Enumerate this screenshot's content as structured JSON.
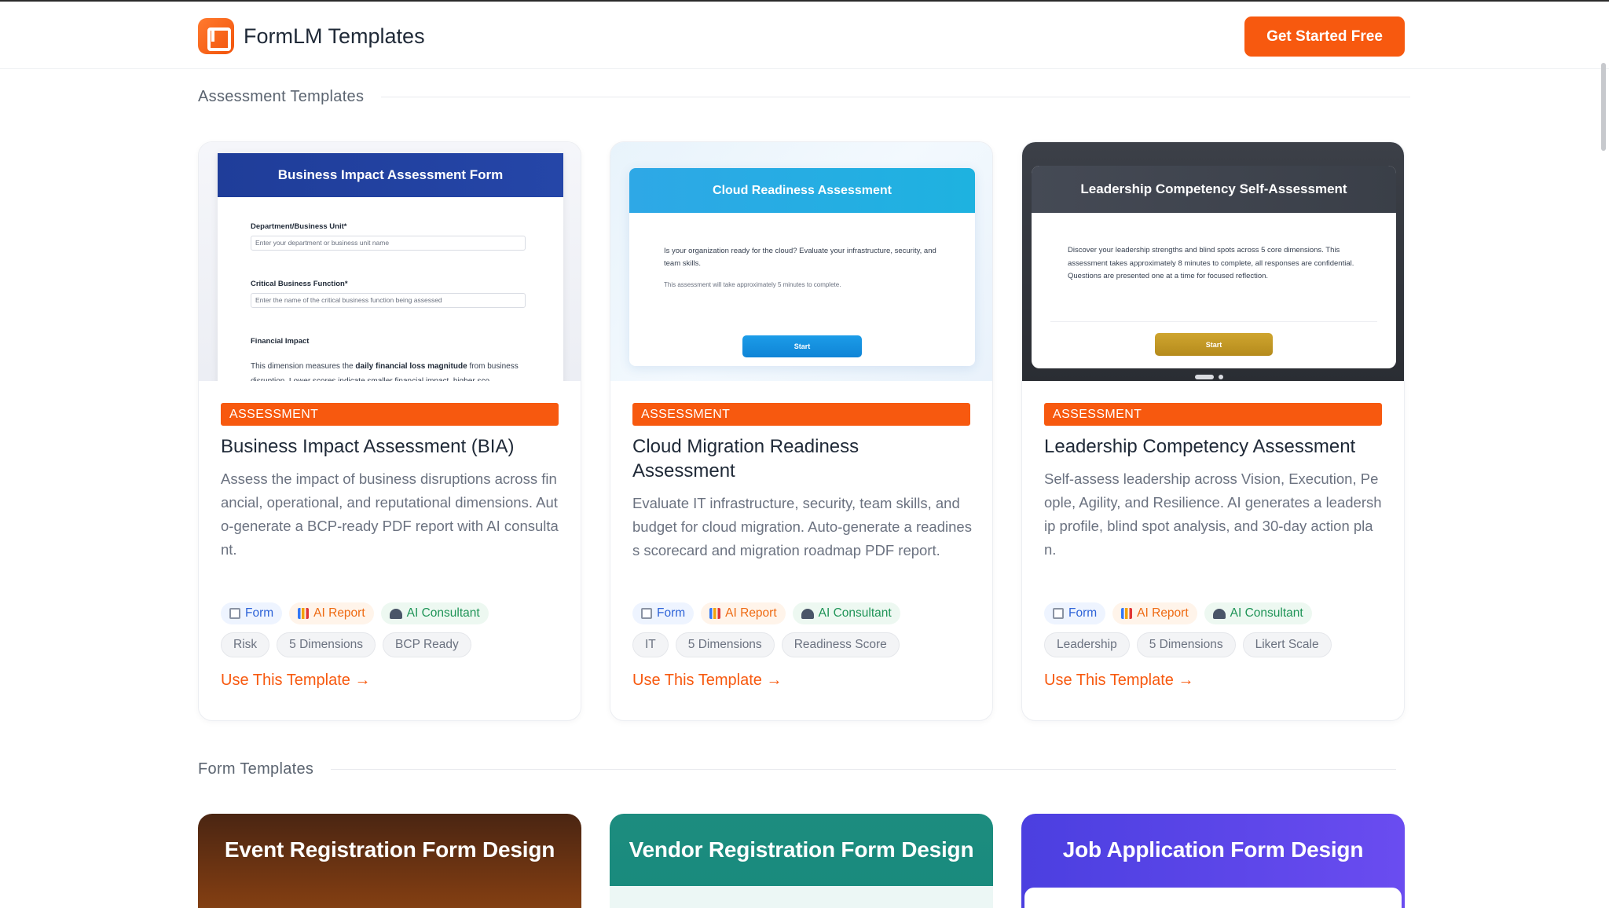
{
  "header": {
    "brand": "FormLM Templates",
    "cta_label": "Get Started Free"
  },
  "sections": {
    "assessment": "Assessment Templates",
    "form": "Form Templates"
  },
  "cards": [
    {
      "tag": "ASSESSMENT",
      "title": "Business Impact Assessment (BIA)",
      "description": "Assess the impact of business disruptions across financial, operational, and reputational dimensions. Auto-generate a BCP-ready PDF report with AI consultant.",
      "features": [
        "Form",
        "AI Report",
        "AI Consultant"
      ],
      "tags": [
        "Risk",
        "5 Dimensions",
        "BCP Ready"
      ],
      "cta": "Use This Template →",
      "preview": {
        "header": "Business Impact Assessment Form",
        "field1_label": "Department/Business Unit*",
        "field1_placeholder": "Enter your department or business unit name",
        "field2_label": "Critical Business Function*",
        "field2_placeholder": "Enter the name of the critical business function being assessed",
        "section_label": "Financial Impact",
        "para_pre": "This dimension measures the ",
        "para_bold": "daily financial loss magnitude",
        "para_post": " from business disruption. Lower scores indicate smaller financial impact, higher sco"
      }
    },
    {
      "tag": "ASSESSMENT",
      "title": "Cloud Migration Readiness Assessment",
      "description": "Evaluate IT infrastructure, security, team skills, and budget for cloud migration. Auto-generate a readiness scorecard and migration roadmap PDF report.",
      "features": [
        "Form",
        "AI Report",
        "AI Consultant"
      ],
      "tags": [
        "IT",
        "5 Dimensions",
        "Readiness Score"
      ],
      "cta": "Use This Template →",
      "preview": {
        "header": "Cloud Readiness Assessment",
        "text": "Is your organization ready for the cloud? Evaluate your infrastructure, security, and team skills.",
        "small": "This assessment will take approximately 5 minutes to complete.",
        "button": "Start"
      }
    },
    {
      "tag": "ASSESSMENT",
      "title": "Leadership Competency Assessment",
      "description": "Self-assess leadership across Vision, Execution, People, Agility, and Resilience. AI generates a leadership profile, blind spot analysis, and 30-day action plan.",
      "features": [
        "Form",
        "AI Report",
        "AI Consultant"
      ],
      "tags": [
        "Leadership",
        "5 Dimensions",
        "Likert Scale"
      ],
      "cta": "Use This Template →",
      "preview": {
        "header": "Leadership Competency Self-Assessment",
        "text": "Discover your leadership strengths and blind spots across 5 core dimensions. This assessment takes approximately 8 minutes to complete, all responses are confidential. Questions are presented one at a time for focused reflection.",
        "button": "Start"
      }
    }
  ],
  "form_templates": [
    {
      "title": "Event Registration Form Design"
    },
    {
      "title": "Vendor Registration Form Design"
    },
    {
      "title": "Job Application Form Design"
    }
  ],
  "colors": {
    "brand": "#f7590f",
    "bia_header": "#2546a8",
    "cloud_header": "#1eb2e0",
    "leadership_button": "#c49a26"
  },
  "icons": {
    "logo": "formlm-logo-icon",
    "form": "form-icon",
    "report": "bar-chart-icon",
    "consultant": "robot-icon"
  }
}
